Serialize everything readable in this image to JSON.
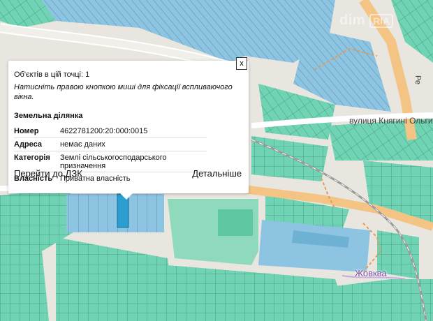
{
  "map": {
    "street_label": "вулиця Княгині Ольги",
    "river_label": "Жовква",
    "road_label": "Ре",
    "watermark_a": "dim",
    "watermark_b": "RIA",
    "colors": {
      "background": "#e9e6e0",
      "parcel_green": "#6fd3b4",
      "parcel_blue": "#8cc4e2",
      "highlight_parcel": "#2a9ed1",
      "road": "#f4c485",
      "railway": "#9a9a9a"
    }
  },
  "popup": {
    "objects_count": "Об'єктів в цій точці: 1",
    "hint": "Натисніть правою кнопкою миші для фіксації вспливаючого вікна.",
    "section_title": "Земельна ділянка",
    "fields": [
      {
        "label": "Номер",
        "value": "4622781200:20:000:0015"
      },
      {
        "label": "Адреса",
        "value": "немає даних"
      },
      {
        "label": "Категорія",
        "value": "Землі сільськогосподарського призначення"
      },
      {
        "label": "Власність",
        "value": "Приватна власність"
      }
    ],
    "close_label": "x",
    "button_dzk": "Перейти до ДЗК",
    "button_details": "Детальніше"
  }
}
